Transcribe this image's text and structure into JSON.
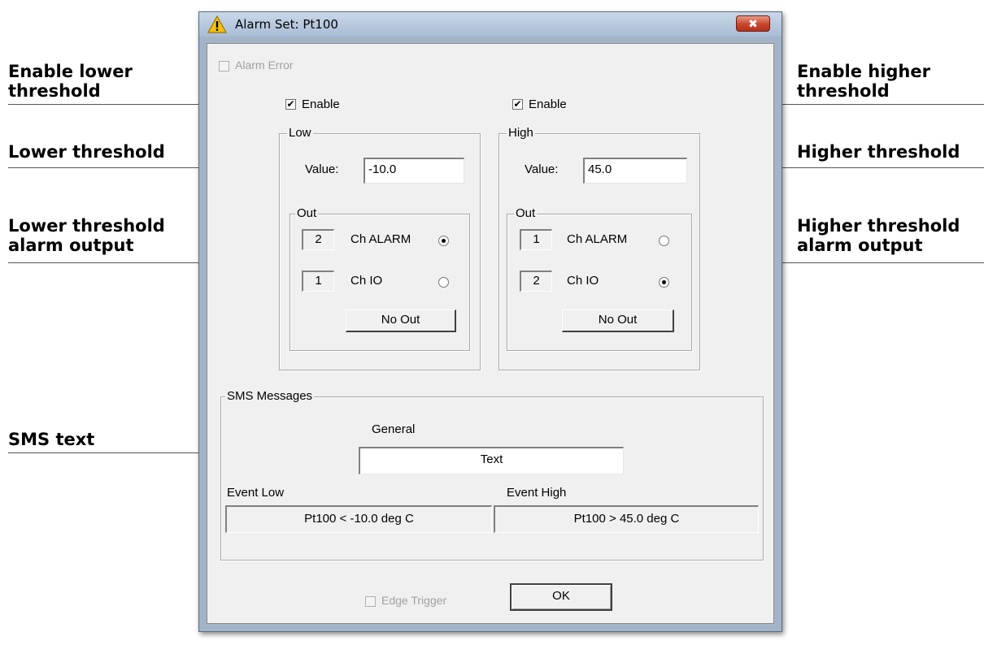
{
  "callouts": {
    "enable_lower": [
      "Enable lower",
      "threshold"
    ],
    "enable_higher": [
      "Enable higher",
      "threshold"
    ],
    "lower_threshold": "Lower threshold",
    "higher_threshold": "Higher threshold",
    "lower_output": [
      "Lower threshold",
      "alarm output"
    ],
    "higher_output": [
      "Higher threshold",
      "alarm output"
    ],
    "sms_text": "SMS text"
  },
  "window": {
    "title": "Alarm Set: Pt100",
    "close_label": "✖",
    "warning_icon": "warning-icon"
  },
  "alarm_error": {
    "label": "Alarm Error",
    "checked": false,
    "enabled": false
  },
  "low": {
    "enable_label": "Enable",
    "enable_checked": true,
    "group_label": "Low",
    "value_label": "Value:",
    "value": "-10.0",
    "out_label": "Out",
    "outputs": [
      {
        "number": "2",
        "label": "Ch ALARM",
        "selected": true
      },
      {
        "number": "1",
        "label": "Ch IO",
        "selected": false
      }
    ],
    "no_out_label": "No Out"
  },
  "high": {
    "enable_label": "Enable",
    "enable_checked": true,
    "group_label": "High",
    "value_label": "Value:",
    "value": "45.0",
    "out_label": "Out",
    "outputs": [
      {
        "number": "1",
        "label": "Ch ALARM",
        "selected": false
      },
      {
        "number": "2",
        "label": "Ch IO",
        "selected": true
      }
    ],
    "no_out_label": "No Out"
  },
  "sms": {
    "group_label": "SMS Messages",
    "general_label": "General",
    "general_text": "Text",
    "event_low_label": "Event Low",
    "event_low_text": "Pt100 < -10.0 deg C",
    "event_high_label": "Event High",
    "event_high_text": "Pt100 > 45.0 deg C"
  },
  "footer": {
    "edge_trigger_label": "Edge Trigger",
    "edge_trigger_checked": false,
    "ok_label": "OK"
  },
  "check_mark": "✔"
}
